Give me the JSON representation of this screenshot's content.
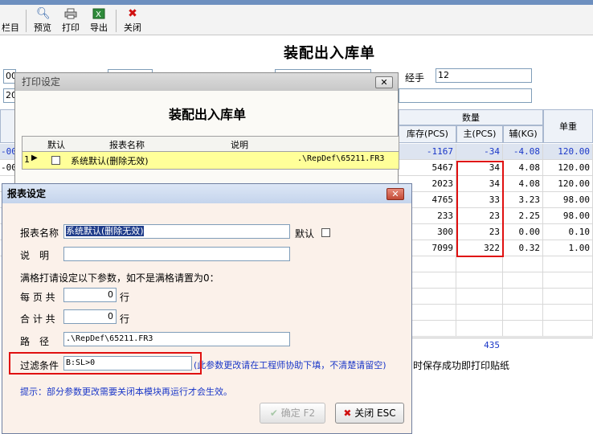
{
  "toolbar": {
    "columns_label": "栏目",
    "preview_label": "预览",
    "print_label": "打印",
    "export_label": "导出",
    "close_label": "关闭"
  },
  "main": {
    "title": "装配出入库单",
    "handler_label": "经手",
    "handler_value": "12",
    "field1_partial": "00",
    "field2_partial": "20",
    "grid": {
      "qty_group_header": "数量",
      "unit_price_header": "单重",
      "col_stock": "库存(PCS)",
      "col_main": "主(PCS)",
      "col_aux": "辅(KG)",
      "rows": [
        {
          "left": "-00",
          "stock": "-1167",
          "main": "-34",
          "aux": "-4.08",
          "price": "120.00"
        },
        {
          "left": "-00",
          "stock": "5467",
          "main": "34",
          "aux": "4.08",
          "price": "120.00"
        },
        {
          "left": "",
          "stock": "2023",
          "main": "34",
          "aux": "4.08",
          "price": "120.00"
        },
        {
          "left": "",
          "stock": "4765",
          "main": "33",
          "aux": "3.23",
          "price": "98.00"
        },
        {
          "left": "",
          "stock": "233",
          "main": "23",
          "aux": "2.25",
          "price": "98.00"
        },
        {
          "left": "",
          "stock": "300",
          "main": "23",
          "aux": "0.00",
          "price": "0.10"
        },
        {
          "left": "",
          "stock": "7099",
          "main": "322",
          "aux": "0.32",
          "price": "1.00"
        }
      ],
      "total_main": "435"
    },
    "footer_note": "时保存成功即打印贴纸"
  },
  "print_window": {
    "title": "打印设定",
    "heading": "装配出入库单",
    "col_default": "默认",
    "col_name": "报表名称",
    "col_desc": "说明",
    "row_index": "1",
    "row_name": "系统默认(删除无效)",
    "row_path": ".\\RepDef\\65211.FR3"
  },
  "report_dialog": {
    "title": "报表设定",
    "name_label": "报表名称",
    "name_value": "系统默认(删除无效)",
    "default_label": "默认",
    "desc_label": "说　明",
    "desc_value": "",
    "hint": "满格打请设定以下参数，如不是满格请置为0：",
    "per_page_label": "每 页 共",
    "per_page_value": "0",
    "per_page_unit": "行",
    "total_label": "合 计 共",
    "total_value": "0",
    "total_unit": "行",
    "path_label": "路　径",
    "path_value": ".\\RepDef\\65211.FR3",
    "filter_label": "过滤条件",
    "filter_value": "B:SL>0",
    "filter_note": "(此参数更改请在工程师协助下填，不清楚请留空)",
    "tip": "提示：部分参数更改需要关闭本模块再运行才会生效。",
    "ok_label": "确定 F2",
    "close_label": "关闭 ESC"
  },
  "colors": {
    "highlight": "#e01010",
    "blue_text": "#1a37c8",
    "selected_row": "#ffff99"
  }
}
